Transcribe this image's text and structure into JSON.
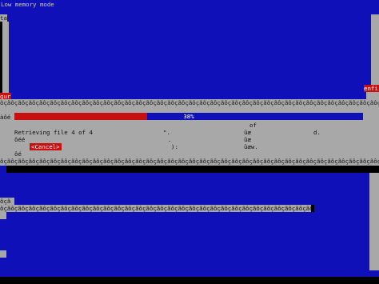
{
  "screen": {
    "title": "Low memory mode",
    "left_labels": [
      "tal",
      "gur"
    ],
    "right_labels": [
      "enfi"
    ],
    "glyph_fill": "àôé"
  },
  "dialog": {
    "frame_text": "ôçãôçãôçãôçãôçãôçãôçãôçãôçãôçãôçãôçãôçãôçãôçãôçãôçãôçãôçãôçãôçãôçãôçãôçãôçãôçãôçãôçãôçãôçãôçãôçãôçãôçãôçãôçãôçãôçãôçã",
    "progress_percent": 38,
    "progress_label": "38%",
    "message": "Retrieving file 4 of 4",
    "message_suffix": "\".",
    "col2_row1": "of",
    "col2_row2": "ûæ",
    "col3_row2": "d.",
    "row3_left": "ôéé",
    "row3_right": "ûæ",
    "row4_mid": "):",
    "row4_right": "ûæw.",
    "row5_left": "ôé",
    "cancel_label": "<Cancel>"
  },
  "lower": {
    "label": "ôçã",
    "bar_text": "ôçãôçãôçãôçãôçãôçãôçãôçãôçãôçãôçãôçãôçãôçãôçãôçãôçãôçãôçãôçãôçãôçãôçãôçãôçãôçãôçãôçãôçãôçãôçãôçãôçãôçãôçãôçãôçã"
  },
  "colors": {
    "background": "#1010b8",
    "dialog_gray": "#a8a8a8",
    "accent_red": "#c81010",
    "shadow": "#000000"
  }
}
